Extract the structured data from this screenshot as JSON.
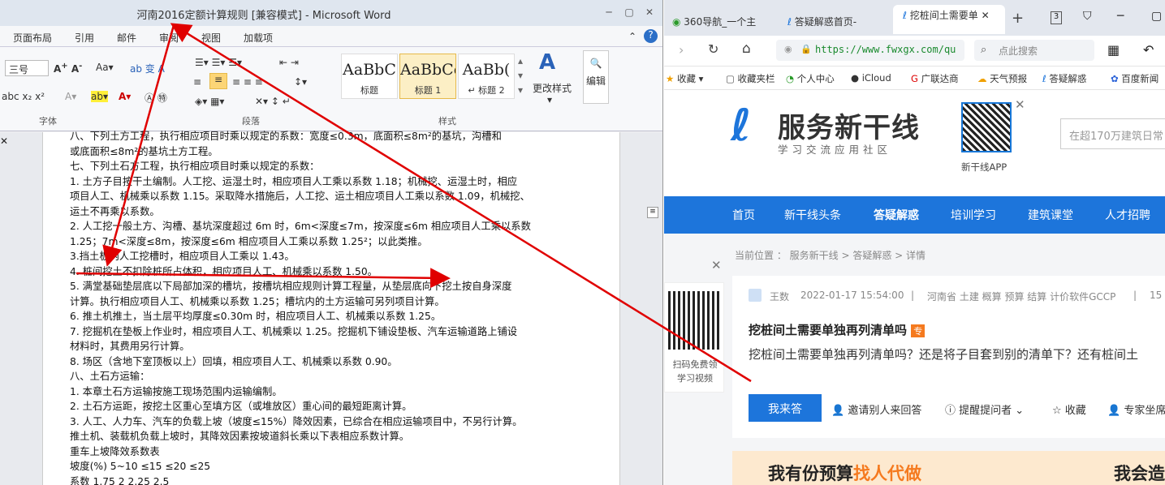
{
  "word": {
    "title": "河南2016定额计算规则 [兼容模式] - Microsoft Word",
    "window_controls": [
      "─",
      "▢",
      "✕"
    ],
    "menu": [
      "页面布局",
      "引用",
      "邮件",
      "审阅",
      "视图",
      "加载项"
    ],
    "ribbon": {
      "font_size": "三号",
      "groups": [
        "字体",
        "段落",
        "样式"
      ],
      "styles": [
        {
          "preview": "AaBbC",
          "label": "标题"
        },
        {
          "preview": "AaBbCc",
          "label": "标题 1"
        },
        {
          "preview": "AaBb(",
          "label": "↵ 标题 2"
        }
      ],
      "change_styles": "更改样式",
      "edit": "编辑"
    },
    "doc_lines": [
      "八、下列土方工程，执行相应项目时乘以规定的系数：宽度≤0.3m，底面积≤8m²的基坑，沟槽和",
      "或底面积≤8m²的基坑土方工程。",
      "七、下列土石方工程，执行相应项目时乘以规定的系数：",
      "1. 土方子目按干土编制。人工挖、运湿土时，相应项目人工乘以系数 1.18；机械挖、运湿土时，相应",
      "项目人工、机械乘以系数 1.15。采取降水措施后，人工挖、运土相应项目人工乘以系数 1.09，机械挖、",
      "运土不再乘以系数。",
      "2. 人工挖一般土方、沟槽、基坑深度超过 6m 时，6m<深度≤7m，按深度≤6m 相应项目人工乘以系数",
      "1.25；7m<深度≤8m，按深度≤6m 相应项目人工乘以系数 1.25²；以此类推。",
      "3.挡土板内人工挖槽时，相应项目人工乘以 1.43。",
      "4. 桩间挖土不扣除桩所占体积，相应项目人工、机械乘以系数 1.50。",
      "5. 满堂基础垫层底以下局部加深的槽坑，按槽坑相应规则计算工程量，从垫层底向下挖土按自身深度",
      "计算。执行相应项目人工、机械乘以系数 1.25；槽坑内的土方运输可另列项目计算。",
      "6. 推土机推土，当土层平均厚度≤0.30m 时，相应项目人工、机械乘以系数 1.25。",
      "7. 挖掘机在垫板上作业时，相应项目人工、机械乘以 1.25。挖掘机下铺设垫板、汽车运输道路上铺设",
      "材料时，其费用另行计算。",
      "8. 场区（含地下室顶板以上）回填，相应项目人工、机械乘以系数 0.90。",
      "八、土石方运输：",
      "1. 本章土石方运输按施工现场范围内运输编制。",
      "2. 土石方运距，按挖土区重心至填方区（或堆放区）重心间的最短距离计算。",
      "3. 人工、人力车、汽车的负载上坡（坡度≤15%）降效因素，已综合在相应运输项目中，不另行计算。",
      "推土机、装载机负载上坡时，其降效因素按坡道斜长乘以下表相应系数计算。",
      "重车上坡降效系数表",
      "坡度(%) 5~10 ≤15 ≤20 ≤25",
      "系数 1.75 2 2.25 2.5"
    ]
  },
  "browser": {
    "tabs": [
      "360导航_一个主",
      "答疑解惑首页-",
      "挖桩间土需要单"
    ],
    "tab_count": "3",
    "url": "https://www.fwxgx.com/qu",
    "search_placeholder": "点此搜索",
    "bookmarks": [
      "收藏",
      "收藏夹栏",
      "个人中心",
      "iCloud",
      "广联达商",
      "天气预报",
      "答疑解惑",
      "百度新闻"
    ],
    "site": {
      "logo": "服务新干线",
      "logo_sub": "学习交流应用社区",
      "app_label": "新干线APP",
      "search_placeholder": "在超170万建筑日常",
      "nav": [
        "首页",
        "新干线头条",
        "答疑解惑",
        "培训学习",
        "建筑课堂",
        "人才招聘"
      ],
      "breadcrumb": "当前位置 ： 服务新干线 > 答疑解惑 > 详情",
      "qr_text_1": "扫码免费领",
      "qr_text_2": "学习视频",
      "author": "王数",
      "date": "2022-01-17 15:54:00",
      "sep": "|",
      "tags": "河南省  土建  概算  预算  结算  计价软件GCCP",
      "views": "15",
      "question_title": "挖桩间土需要单独再列清单吗",
      "badge": "专",
      "question_body": "挖桩间土需要单独再列清单吗？还是将子目套到别的清单下？还有桩间土",
      "answer_button": "我来答",
      "invite": "邀请别人来回答",
      "remind": "提醒提问者",
      "favorite": "收藏",
      "expert": "专家坐席",
      "banner_left_prefix": "我有份预算",
      "banner_left_accent": "找人代做",
      "banner_right": "我会造"
    }
  },
  "colors": {
    "accent_blue": "#1d75db",
    "annotation_red": "#e00000",
    "banner_orange": "#f57a1f"
  }
}
